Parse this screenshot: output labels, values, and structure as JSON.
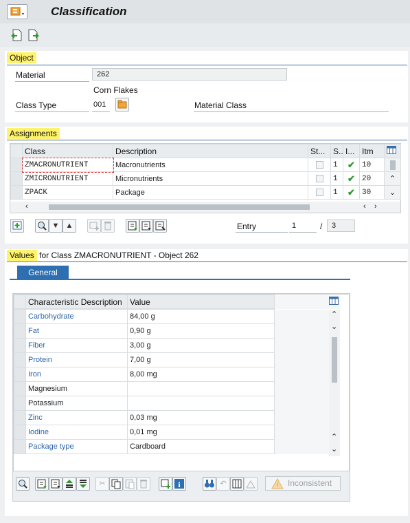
{
  "header": {
    "title": "Classification"
  },
  "object": {
    "section_label": "Object",
    "material_label": "Material",
    "material_value": "262",
    "material_description": "Corn Flakes",
    "class_type_label": "Class Type",
    "class_type_value": "001",
    "class_type_description": "Material Class"
  },
  "assignments": {
    "section_label": "Assignments",
    "columns": [
      "Class",
      "Description",
      "St...",
      "S...",
      "I...",
      "Itm"
    ],
    "rows": [
      {
        "class": "ZMACRONUTRIENT",
        "description": "Macronutrients",
        "s": "1",
        "itm": "10"
      },
      {
        "class": "ZMICRONUTRIENT",
        "description": "Micronutrients",
        "s": "1",
        "itm": "20"
      },
      {
        "class": "ZPACK",
        "description": "Package",
        "s": "1",
        "itm": "30"
      }
    ],
    "entry_label": "Entry",
    "entry_value": "1",
    "entry_sep": "/",
    "entry_total": "3"
  },
  "values": {
    "title_prefix": "Values",
    "title_rest": " for Class ZMACRONUTRIENT - Object 262",
    "tab_general": "General",
    "columns": [
      "Characteristic Description",
      "Value"
    ],
    "rows": [
      {
        "name": "Carbohydrate",
        "value": "84,00 g",
        "link": true
      },
      {
        "name": "Fat",
        "value": "0,90 g",
        "link": true
      },
      {
        "name": "Fiber",
        "value": "3,00 g",
        "link": true
      },
      {
        "name": "Protein",
        "value": "7,00 g",
        "link": true
      },
      {
        "name": "Iron",
        "value": "8,00 mg",
        "link": true
      },
      {
        "name": "Magnesium",
        "value": "",
        "link": false
      },
      {
        "name": "Potassium",
        "value": "",
        "link": false
      },
      {
        "name": "Zinc",
        "value": "0,03 mg",
        "link": true
      },
      {
        "name": "Iodine",
        "value": "0,01 mg",
        "link": true
      },
      {
        "name": "Package type",
        "value": "Cardboard",
        "link": true
      }
    ],
    "inconsistent_label": "Inconsistent"
  },
  "colors": {
    "highlight": "#fff36b",
    "accent": "#2d6fb0",
    "link": "#2b66aa",
    "check": "#2e9a2e"
  }
}
